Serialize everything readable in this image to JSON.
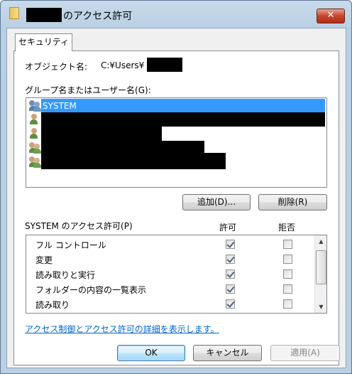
{
  "window": {
    "title_suffix": "のアクセス許可",
    "close_glyph": "✕"
  },
  "tabs": [
    {
      "label": "セキュリティ"
    }
  ],
  "object": {
    "label": "オブジェクト名:",
    "path": "C:¥Users¥"
  },
  "groups": {
    "label": "グループ名またはユーザー名(G):",
    "items": [
      {
        "name": "SYSTEM",
        "selected": true,
        "icon": "users-group-icon"
      },
      {
        "name": "",
        "selected": false,
        "icon": "user-icon"
      },
      {
        "name": "",
        "selected": false,
        "icon": "user-icon"
      },
      {
        "name": "",
        "selected": false,
        "icon": "users-group-icon"
      },
      {
        "name": "",
        "selected": false,
        "icon": "users-group-icon"
      }
    ]
  },
  "buttons": {
    "add": "追加(D)...",
    "remove": "削除(R)",
    "ok": "OK",
    "cancel": "キャンセル",
    "apply": "適用(A)"
  },
  "permissions": {
    "title": "SYSTEM のアクセス許可(P)",
    "allow_header": "許可",
    "deny_header": "拒否",
    "rows": [
      {
        "name": "フル コントロール",
        "allow": true,
        "deny": false
      },
      {
        "name": "変更",
        "allow": true,
        "deny": false
      },
      {
        "name": "読み取りと実行",
        "allow": true,
        "deny": false
      },
      {
        "name": "フォルダーの内容の一覧表示",
        "allow": true,
        "deny": false
      },
      {
        "name": "読み取り",
        "allow": true,
        "deny": false
      }
    ]
  },
  "help_link": "アクセス制御とアクセス許可の詳細を表示します。",
  "colors": {
    "selection": "#3399ff",
    "link": "#0066cc",
    "close_button": "#c7452f"
  }
}
